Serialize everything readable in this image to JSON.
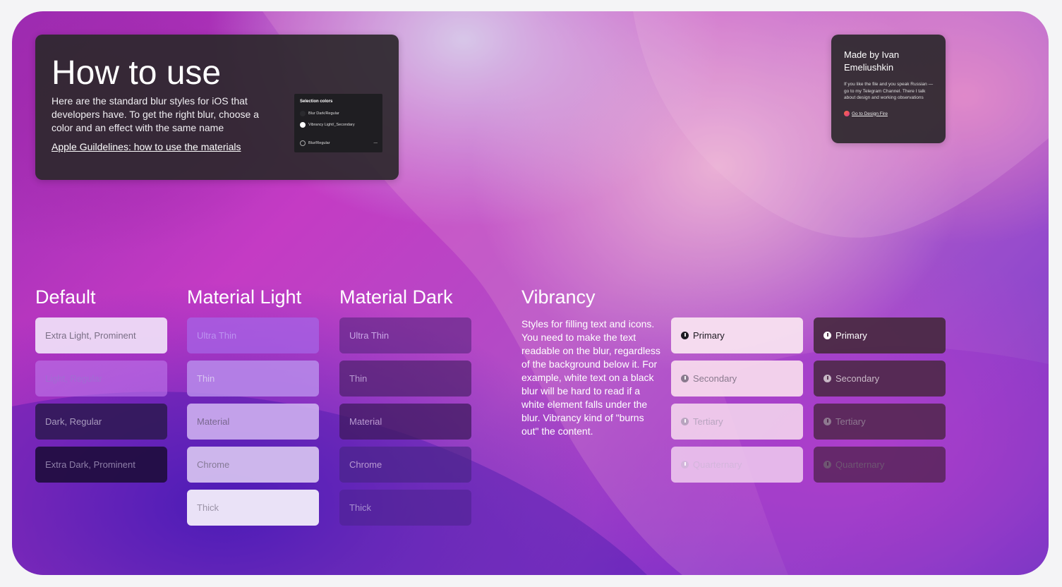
{
  "how_to_use": {
    "title": "How to use",
    "description": "Here are the standard blur styles for iOS that developers have. To get the right blur, choose a color and an effect with the same name",
    "link": "Apple Guildelines: how to use the materials",
    "selection_panel": {
      "title": "Selection colors",
      "items": [
        "Blur Dark/Regular",
        "Vibrancy Light/_Secondary",
        "Blur/Regular"
      ],
      "minus": "—"
    }
  },
  "made_by": {
    "title": "Made by Ivan Emeliushkin",
    "description": "If you like the file and you speak Russian — go to my Telegram Channel. There I talk about design and working observations",
    "link": "Go to Design Fire"
  },
  "sections": {
    "default": {
      "title": "Default",
      "items": [
        "Extra Light, Prominent",
        "Light, Regular",
        "Dark, Regular",
        "Extra Dark, Prominent"
      ]
    },
    "material_light": {
      "title": "Material Light",
      "items": [
        "Ultra Thin",
        "Thin",
        "Material",
        "Chrome",
        "Thick"
      ]
    },
    "material_dark": {
      "title": "Material Dark",
      "items": [
        "Ultra Thin",
        "Thin",
        "Material",
        "Chrome",
        "Thick"
      ]
    },
    "vibrancy": {
      "title": "Vibrancy",
      "description": "Styles for filling text and icons. You need to make the text readable on the blur, regardless of the background below it. For example, white text on a black blur will be hard to read if a white element falls under the blur. Vibrancy kind of \"burns out\" the content.",
      "light_items": [
        "Primary",
        "Secondary",
        "Tertiary",
        "Quarternary"
      ],
      "dark_items": [
        "Primary",
        "Secondary",
        "Tertiary",
        "Quarternary"
      ]
    }
  }
}
